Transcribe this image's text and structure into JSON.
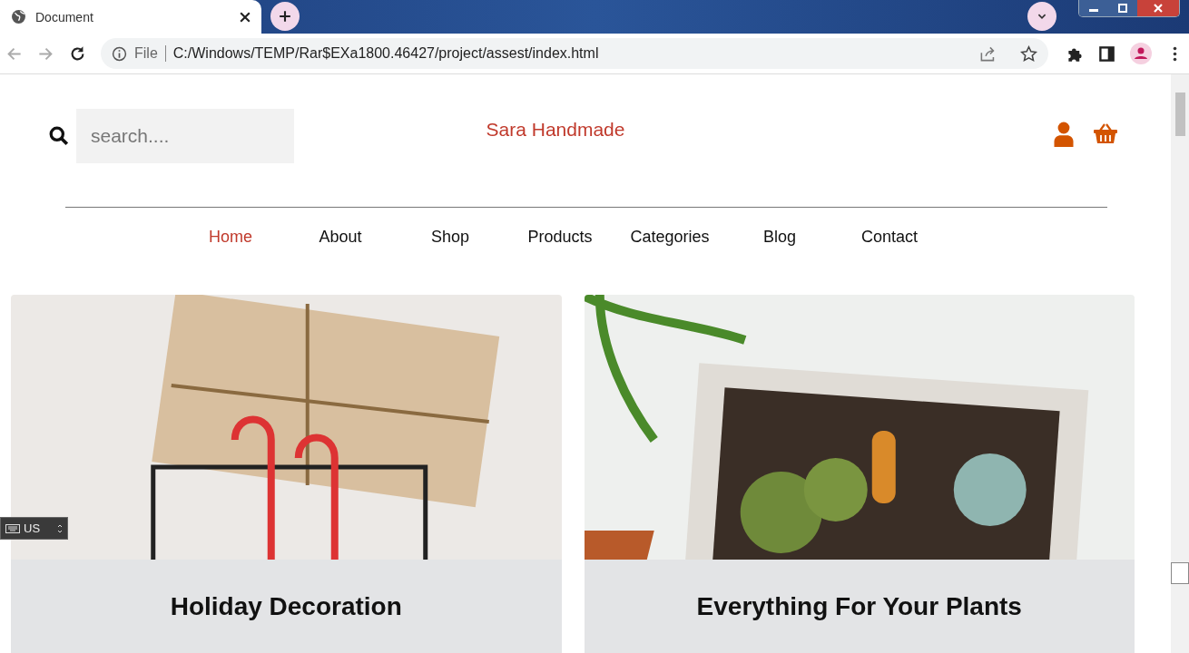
{
  "browser": {
    "tab": {
      "title": "Document"
    },
    "address": {
      "scheme": "File",
      "url": "C:/Windows/TEMP/Rar$EXa1800.46427/project/assest/index.html"
    }
  },
  "page": {
    "search": {
      "placeholder": "search...."
    },
    "brand": "Sara Handmade",
    "nav": [
      {
        "label": "Home",
        "selected": true
      },
      {
        "label": "About",
        "selected": false
      },
      {
        "label": "Shop",
        "selected": false
      },
      {
        "label": "Products",
        "selected": false
      },
      {
        "label": "Categories",
        "selected": false
      },
      {
        "label": "Blog",
        "selected": false
      },
      {
        "label": "Contact",
        "selected": false
      }
    ],
    "cards": [
      {
        "title": "Holiday Decoration"
      },
      {
        "title": "Everything For Your Plants"
      }
    ]
  },
  "language_bar": {
    "label": "US"
  }
}
